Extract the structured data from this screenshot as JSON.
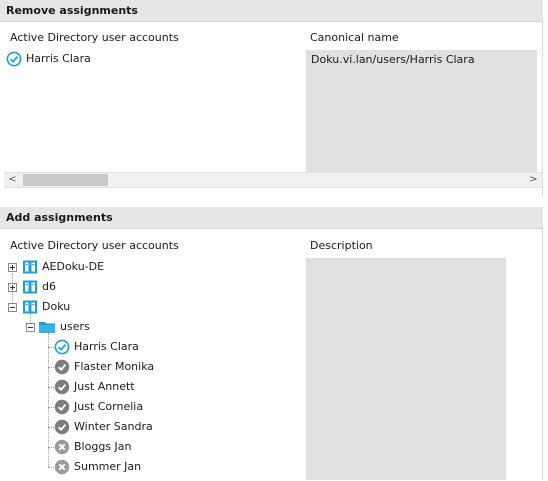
{
  "remove_section": {
    "title": "Remove assignments",
    "col_accounts": "Active Directory user accounts",
    "col_canonical": "Canonical name",
    "rows": [
      {
        "name": "Harris Clara",
        "canonical": "Doku.vi.lan/users/Harris Clara",
        "status": "check-blue-icon"
      }
    ],
    "scroll_left": "<",
    "scroll_right": ">"
  },
  "add_section": {
    "title": "Add assignments",
    "col_accounts": "Active Directory user accounts",
    "col_description": "Description",
    "domains": [
      "AEDoku-DE",
      "d6",
      "Doku"
    ],
    "folder": "users",
    "users": [
      {
        "name": "Harris Clara",
        "status": "check-blue-icon"
      },
      {
        "name": "Flaster Monika",
        "status": "check-gray-icon"
      },
      {
        "name": "Just Annett",
        "status": "check-gray-icon"
      },
      {
        "name": "Just Cornelia",
        "status": "check-gray-icon"
      },
      {
        "name": "Winter Sandra",
        "status": "check-gray-icon"
      },
      {
        "name": "Bloggs Jan",
        "status": "x-gray-icon"
      },
      {
        "name": "Summer Jan",
        "status": "x-gray-icon"
      }
    ]
  },
  "colors": {
    "header_bg": "#e6e6e6",
    "column_bg": "#e0e0e0",
    "accent_blue": "#1a9fde",
    "status_gray": "#7b7b7b"
  }
}
